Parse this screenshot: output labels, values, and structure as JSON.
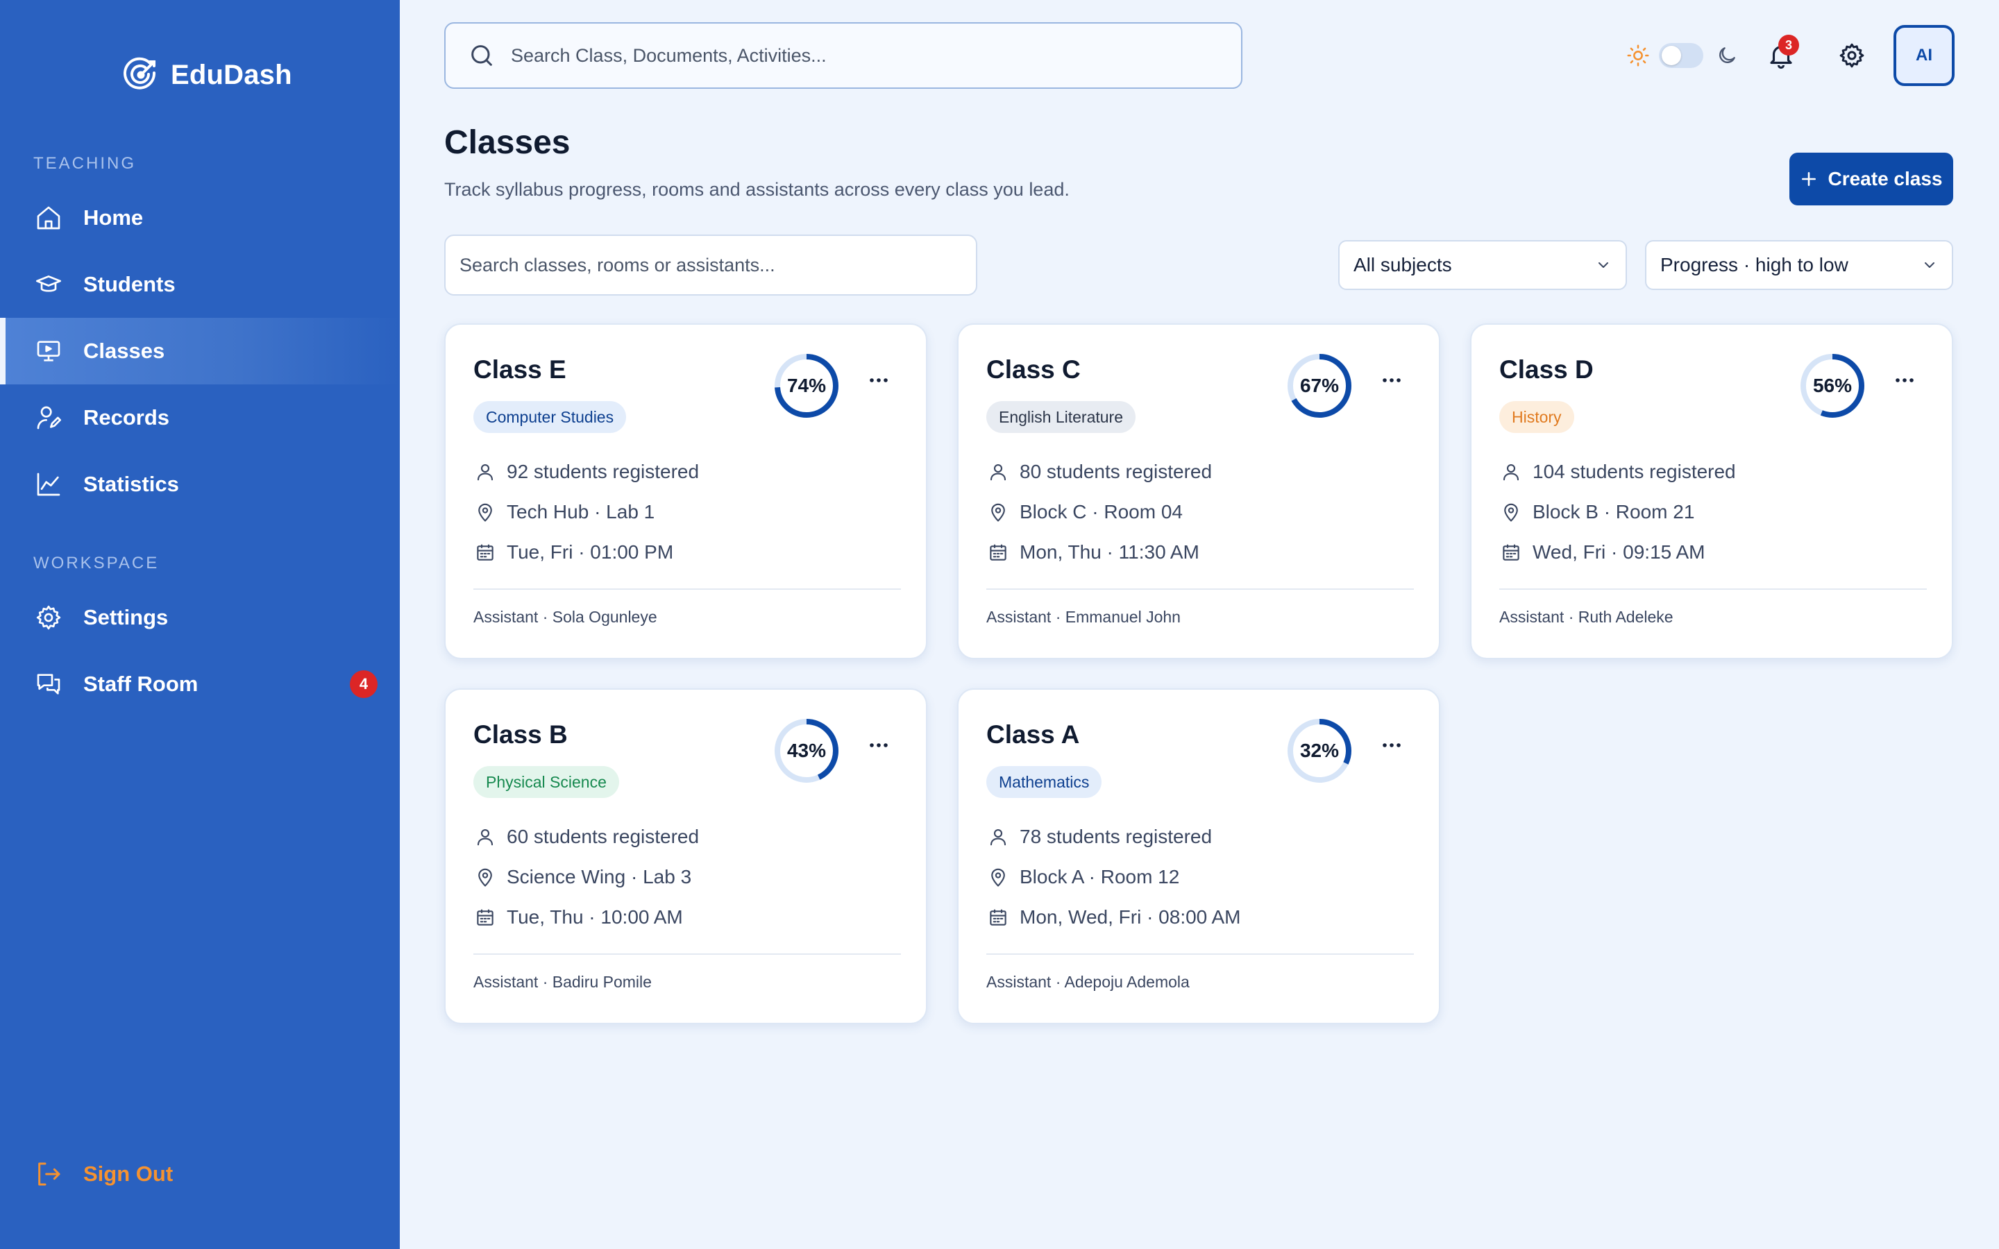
{
  "app": {
    "name": "EduDash"
  },
  "sidebar": {
    "sections": [
      "TEACHING",
      "WORKSPACE"
    ],
    "items": [
      {
        "label": "Home",
        "icon": "home-icon"
      },
      {
        "label": "Students",
        "icon": "graduation-cap-icon"
      },
      {
        "label": "Classes",
        "icon": "monitor-icon",
        "active": true
      },
      {
        "label": "Records",
        "icon": "user-edit-icon"
      },
      {
        "label": "Statistics",
        "icon": "line-chart-icon"
      },
      {
        "label": "Settings",
        "icon": "gear-icon"
      },
      {
        "label": "Staff Room",
        "icon": "chat-icon",
        "badge": "4"
      }
    ],
    "signout": "Sign Out"
  },
  "header": {
    "search_placeholder": "Search Class, Documents, Activities...",
    "notifications": "3",
    "avatar": "AI"
  },
  "page": {
    "title": "Classes",
    "subtitle": "Track syllabus progress, rooms and assistants across every class you lead.",
    "create_label": "Create class",
    "filter_placeholder": "Search classes, rooms or assistants...",
    "subject_filter": "All subjects",
    "sort": "Progress · high to low"
  },
  "classes": [
    {
      "name": "Class E",
      "subject": "Computer Studies",
      "subject_bg": "#e3edfb",
      "subject_fg": "#0d3f8f",
      "progress": 74,
      "progress_label": "74%",
      "students": "92 students registered",
      "location": "Tech Hub · Lab 1",
      "schedule": "Tue, Fri · 01:00 PM",
      "assistant": "Assistant · Sola Ogunleye"
    },
    {
      "name": "Class C",
      "subject": "English Literature",
      "subject_bg": "#e8ecf2",
      "subject_fg": "#2b3548",
      "progress": 67,
      "progress_label": "67%",
      "students": "80 students registered",
      "location": "Block C · Room 04",
      "schedule": "Mon, Thu · 11:30 AM",
      "assistant": "Assistant · Emmanuel John"
    },
    {
      "name": "Class D",
      "subject": "History",
      "subject_bg": "#fdeedd",
      "subject_fg": "#e07a1f",
      "progress": 56,
      "progress_label": "56%",
      "students": "104 students registered",
      "location": "Block B · Room 21",
      "schedule": "Wed, Fri · 09:15 AM",
      "assistant": "Assistant · Ruth Adeleke"
    },
    {
      "name": "Class B",
      "subject": "Physical Science",
      "subject_bg": "#e3f5ec",
      "subject_fg": "#16894f",
      "progress": 43,
      "progress_label": "43%",
      "students": "60 students registered",
      "location": "Science Wing · Lab 3",
      "schedule": "Tue, Thu · 10:00 AM",
      "assistant": "Assistant · Badiru Pomile"
    },
    {
      "name": "Class A",
      "subject": "Mathematics",
      "subject_bg": "#e3edfb",
      "subject_fg": "#0d3f8f",
      "progress": 32,
      "progress_label": "32%",
      "students": "78 students registered",
      "location": "Block A · Room 12",
      "schedule": "Mon, Wed, Fri · 08:00 AM",
      "assistant": "Assistant · Adepoju Ademola"
    }
  ],
  "colors": {
    "sidebar": "#2a61c0",
    "accent": "#0d4aa8",
    "ring_track": "#d6e4f7",
    "signout": "#f59230",
    "badge": "#dc2626"
  }
}
